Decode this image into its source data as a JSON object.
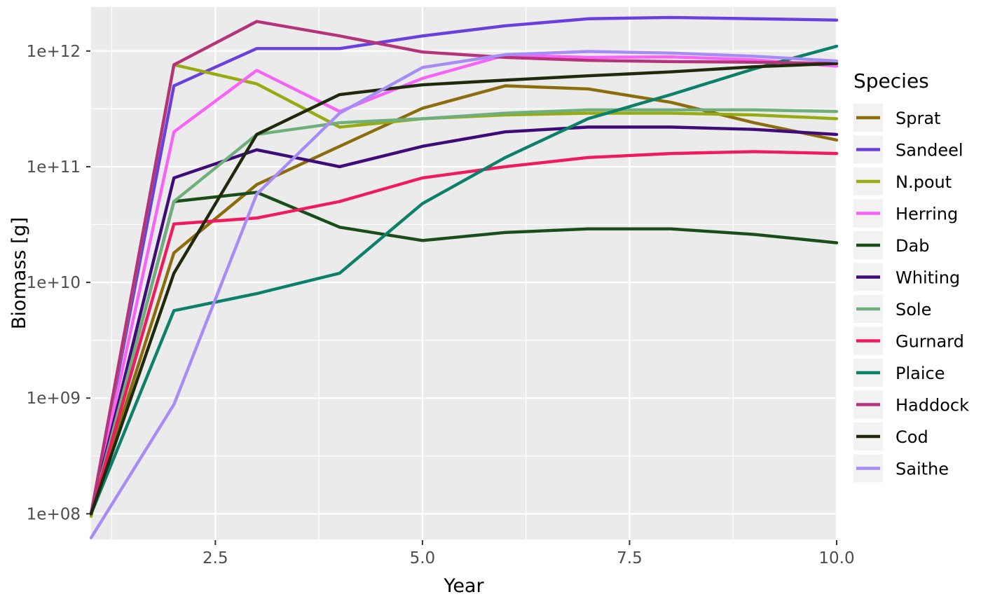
{
  "chart_data": {
    "type": "line",
    "title": "",
    "xlabel": "Year",
    "ylabel": "Biomass [g]",
    "legend_title": "Species",
    "legend_position": "right",
    "grid": true,
    "yscale": "log",
    "xlim": [
      1,
      10
    ],
    "ylim": [
      60000000,
      2400000000000
    ],
    "x": [
      1,
      2,
      3,
      4,
      5,
      6,
      7,
      8,
      9,
      10
    ],
    "xticks": [
      2.5,
      5.0,
      7.5,
      10.0
    ],
    "xticklabels": [
      "2.5",
      "5.0",
      "7.5",
      "10.0"
    ],
    "yticks": [
      100000000,
      1000000000,
      10000000000,
      100000000000,
      1000000000000
    ],
    "yticklabels": [
      "1e+08",
      "1e+09",
      "1e+10",
      "1e+11",
      "1e+12"
    ],
    "series": [
      {
        "name": "Sprat",
        "color": "#8C6D0D",
        "values": [
          100000000.0,
          18000000000.0,
          70000000000.0,
          150000000000.0,
          320000000000.0,
          500000000000.0,
          470000000000.0,
          360000000000.0,
          240000000000.0,
          170000000000.0
        ]
      },
      {
        "name": "Sandeel",
        "color": "#6A3FE0",
        "values": [
          100000000.0,
          500000000000.0,
          1050000000000.0,
          1050000000000.0,
          1350000000000.0,
          1650000000000.0,
          1900000000000.0,
          1950000000000.0,
          1900000000000.0,
          1850000000000.0
        ]
      },
      {
        "name": "N.pout",
        "color": "#97AA12",
        "values": [
          95000000.0,
          760000000000.0,
          520000000000.0,
          220000000000.0,
          260000000000.0,
          280000000000.0,
          290000000000.0,
          290000000000.0,
          280000000000.0,
          260000000000.0
        ]
      },
      {
        "name": "Herring",
        "color": "#F763F7",
        "values": [
          100000000.0,
          200000000000.0,
          680000000000.0,
          300000000000.0,
          580000000000.0,
          920000000000.0,
          880000000000.0,
          890000000000.0,
          840000000000.0,
          740000000000.0
        ]
      },
      {
        "name": "Dab",
        "color": "#194D19",
        "values": [
          100000000.0,
          50000000000.0,
          60000000000.0,
          30000000000.0,
          23000000000.0,
          27000000000.0,
          29000000000.0,
          29000000000.0,
          26000000000.0,
          22000000000.0
        ]
      },
      {
        "name": "Whiting",
        "color": "#3E0B78",
        "values": [
          100000000.0,
          80000000000.0,
          140000000000.0,
          100000000000.0,
          150000000000.0,
          200000000000.0,
          220000000000.0,
          220000000000.0,
          210000000000.0,
          190000000000.0
        ]
      },
      {
        "name": "Sole",
        "color": "#6FAF7C",
        "values": [
          100000000.0,
          50000000000.0,
          190000000000.0,
          240000000000.0,
          260000000000.0,
          290000000000.0,
          310000000000.0,
          310000000000.0,
          310000000000.0,
          300000000000.0
        ]
      },
      {
        "name": "Gurnard",
        "color": "#F01A5E",
        "values": [
          100000000.0,
          32000000000.0,
          36000000000.0,
          50000000000.0,
          80000000000.0,
          100000000000.0,
          120000000000.0,
          130000000000.0,
          135000000000.0,
          130000000000.0
        ]
      },
      {
        "name": "Plaice",
        "color": "#0C8069",
        "values": [
          100000000.0,
          5700000000.0,
          8000000000.0,
          12000000000.0,
          48000000000.0,
          120000000000.0,
          260000000000.0,
          420000000000.0,
          700000000000.0,
          1100000000000.0
        ]
      },
      {
        "name": "Haddock",
        "color": "#B5337A",
        "values": [
          100000000.0,
          760000000000.0,
          1800000000000.0,
          1350000000000.0,
          980000000000.0,
          880000000000.0,
          830000000000.0,
          810000000000.0,
          800000000000.0,
          780000000000.0
        ]
      },
      {
        "name": "Cod",
        "color": "#1E2A0B",
        "values": [
          100000000.0,
          12000000000.0,
          190000000000.0,
          420000000000.0,
          510000000000.0,
          560000000000.0,
          610000000000.0,
          660000000000.0,
          730000000000.0,
          780000000000.0
        ]
      },
      {
        "name": "Saithe",
        "color": "#A88CF5",
        "values": [
          62000000.0,
          880000000.0,
          58000000000.0,
          290000000000.0,
          720000000000.0,
          930000000000.0,
          990000000000.0,
          960000000000.0,
          900000000000.0,
          820000000000.0
        ]
      }
    ]
  }
}
